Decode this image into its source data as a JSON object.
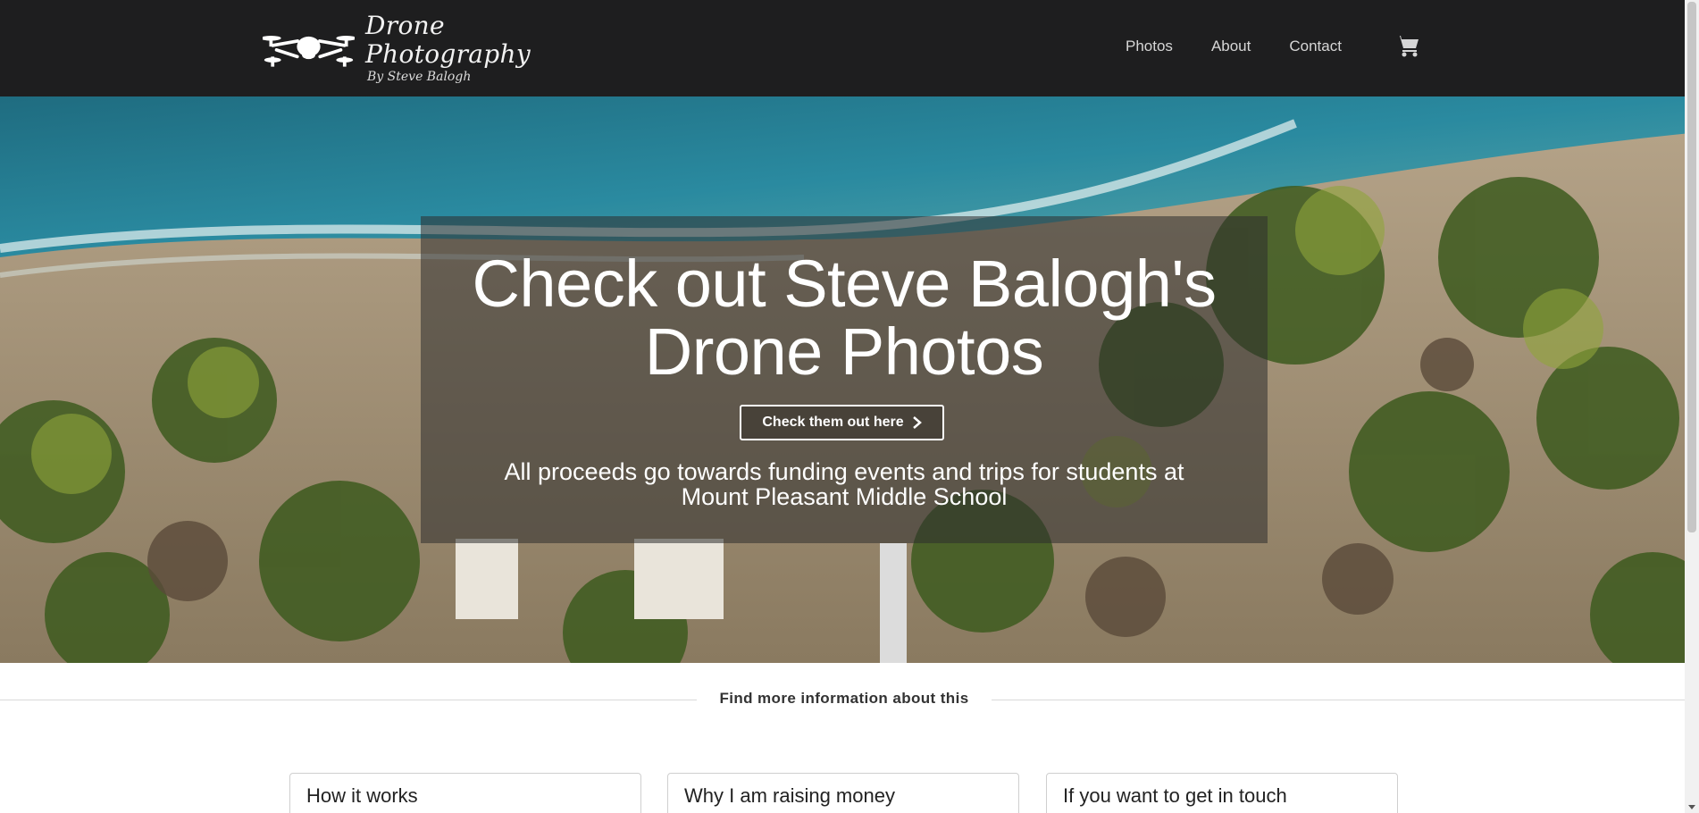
{
  "header": {
    "brand_title": "Drone Photography",
    "brand_subtitle": "By Steve Balogh",
    "logo_icon": "drone-icon",
    "nav": [
      {
        "label": "Photos"
      },
      {
        "label": "About"
      },
      {
        "label": "Contact"
      }
    ],
    "cart_icon": "shopping-cart-icon"
  },
  "hero": {
    "title_line1": "Check out Steve Balogh's",
    "title_line2": "Drone Photos",
    "cta_label": "Check them out here",
    "cta_icon": "chevron-right-icon",
    "description_line1": "All proceeds go towards funding events and trips for students at",
    "description_line2": "Mount Pleasant Middle School"
  },
  "section": {
    "divider_label": "Find more information about this"
  },
  "cards": [
    {
      "title": "How it works"
    },
    {
      "title": "Why I am raising money"
    },
    {
      "title": "If you want to get in touch"
    }
  ],
  "colors": {
    "header_bg": "#1e1e1f",
    "hero_overlay": "#2d2d2d",
    "text_light": "#ffffff"
  }
}
